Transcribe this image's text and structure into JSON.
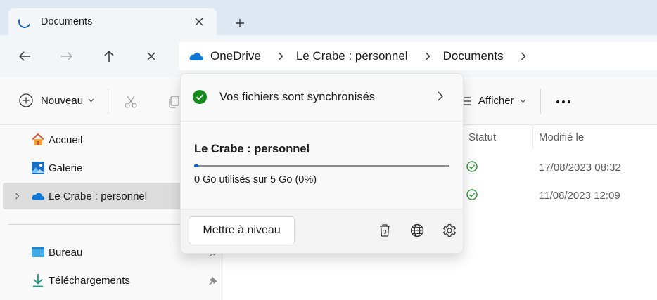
{
  "tab": {
    "title": "Documents"
  },
  "address": {
    "crumbs": [
      "OneDrive",
      "Le Crabe : personnel",
      "Documents"
    ]
  },
  "toolbar": {
    "new_label": "Nouveau",
    "view_label": "Afficher"
  },
  "sidebar": {
    "items": [
      {
        "label": "Accueil",
        "icon": "home-icon"
      },
      {
        "label": "Galerie",
        "icon": "gallery-icon"
      },
      {
        "label": "Le Crabe : personnel",
        "icon": "onedrive-cloud-icon"
      },
      {
        "label": "Bureau",
        "icon": "desktop-folder-icon"
      },
      {
        "label": "Téléchargements",
        "icon": "download-icon"
      }
    ]
  },
  "content": {
    "columns": [
      "Statut",
      "Modifié le"
    ],
    "rows": [
      {
        "status": "synced",
        "date": "17/08/2023 08:32"
      },
      {
        "status": "synced",
        "date": "11/08/2023 12:09"
      }
    ]
  },
  "flyout": {
    "sync_status": "Vos fichiers sont synchronisés",
    "account": "Le Crabe : personnel",
    "usage": "0 Go utilisés sur 5 Go (0%)",
    "usage_fraction": 0.01,
    "upgrade_label": "Mettre à niveau"
  },
  "colors": {
    "accent": "#0a5fcc",
    "success": "#138a1c",
    "onedrive": "#0f78d4"
  }
}
